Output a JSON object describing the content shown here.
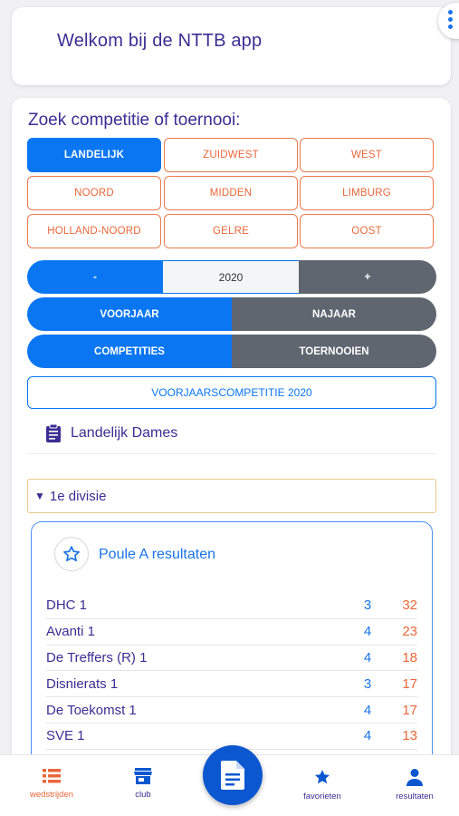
{
  "header": {
    "title": "Welkom bij de NTTB app"
  },
  "search": {
    "title": "Zoek competitie of toernooi:",
    "regions": [
      {
        "label": "LANDELIJK",
        "active": true
      },
      {
        "label": "ZUIDWEST",
        "active": false
      },
      {
        "label": "WEST",
        "active": false
      },
      {
        "label": "NOORD",
        "active": false
      },
      {
        "label": "MIDDEN",
        "active": false
      },
      {
        "label": "LIMBURG",
        "active": false
      },
      {
        "label": "HOLLAND-NOORD",
        "active": false
      },
      {
        "label": "GELRE",
        "active": false
      },
      {
        "label": "OOST",
        "active": false
      }
    ],
    "year": {
      "minus": "-",
      "value": "2020",
      "plus": "+"
    },
    "season": {
      "spring": "VOORJAAR",
      "autumn": "NAJAAR",
      "selected": "spring"
    },
    "type": {
      "competitions": "COMPETITIES",
      "tournaments": "TOERNOOIEN",
      "selected": "competitions"
    },
    "competition_button": "VOORJAARSCOMPETITIE 2020",
    "competition": {
      "icon": "clipboard-icon",
      "name": "Landelijk Dames"
    },
    "division": {
      "caret": "▼",
      "label": "1e divisie"
    }
  },
  "poule": {
    "title": "Poule A resultaten",
    "icon": "star-outline-icon",
    "standings": [
      {
        "team": "DHC 1",
        "played": "3",
        "points": "32"
      },
      {
        "team": "Avanti 1",
        "played": "4",
        "points": "23"
      },
      {
        "team": "De Treffers (R) 1",
        "played": "4",
        "points": "18"
      },
      {
        "team": "Disnierats 1",
        "played": "3",
        "points": "17"
      },
      {
        "team": "De Toekomst 1",
        "played": "4",
        "points": "17"
      },
      {
        "team": "SVE 1",
        "played": "4",
        "points": "13"
      }
    ]
  },
  "nav": {
    "items": [
      {
        "label": "wedstrijden",
        "icon": "list-icon",
        "active": true
      },
      {
        "label": "club",
        "icon": "store-icon",
        "active": false
      },
      {
        "label": "favorieten",
        "icon": "star-icon",
        "active": false
      },
      {
        "label": "resultaten",
        "icon": "person-icon",
        "active": false
      }
    ],
    "center_icon": "document-icon"
  },
  "colors": {
    "primary": "#0a76f2",
    "accent": "#e8673a",
    "heading": "#3b2e93",
    "grey": "#5f6670"
  }
}
